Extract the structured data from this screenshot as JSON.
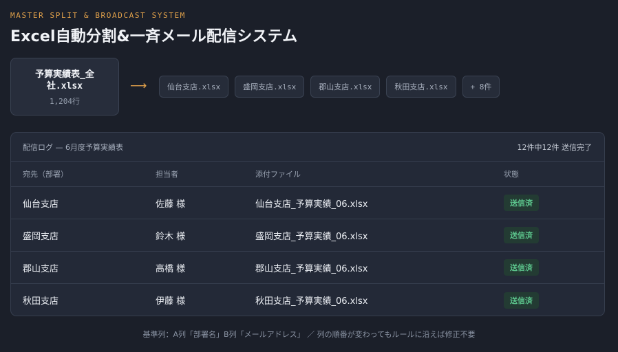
{
  "eyebrow": "MASTER SPLIT & BROADCAST SYSTEM",
  "title": "Excel自動分割&一斉メール配信システム",
  "source": {
    "filename": "予算実績表_全社.xlsx",
    "rows": "1,204行"
  },
  "arrow": "⟶",
  "chips": [
    "仙台支店.xlsx",
    "盛岡支店.xlsx",
    "郡山支店.xlsx",
    "秋田支店.xlsx",
    "+ 8件"
  ],
  "log": {
    "title": "配信ログ — 6月度予算実績表",
    "status": "12件中12件 送信完了",
    "columns": [
      "宛先（部署）",
      "担当者",
      "添付ファイル",
      "状態"
    ],
    "rows": [
      {
        "dept": "仙台支店",
        "person": "佐藤 様",
        "file": "仙台支店_予算実績_06.xlsx",
        "status": "送信済"
      },
      {
        "dept": "盛岡支店",
        "person": "鈴木 様",
        "file": "盛岡支店_予算実績_06.xlsx",
        "status": "送信済"
      },
      {
        "dept": "郡山支店",
        "person": "高橋 様",
        "file": "郡山支店_予算実績_06.xlsx",
        "status": "送信済"
      },
      {
        "dept": "秋田支店",
        "person": "伊藤 様",
        "file": "秋田支店_予算実績_06.xlsx",
        "status": "送信済"
      }
    ]
  },
  "footnote": "基準列：A列「部署名」B列「メールアドレス」 ／ 列の順番が変わってもルールに沿えば修正不要",
  "colors": {
    "accent": "#e0a04a",
    "success": "#5cc48c",
    "background": "#1b1f29"
  }
}
